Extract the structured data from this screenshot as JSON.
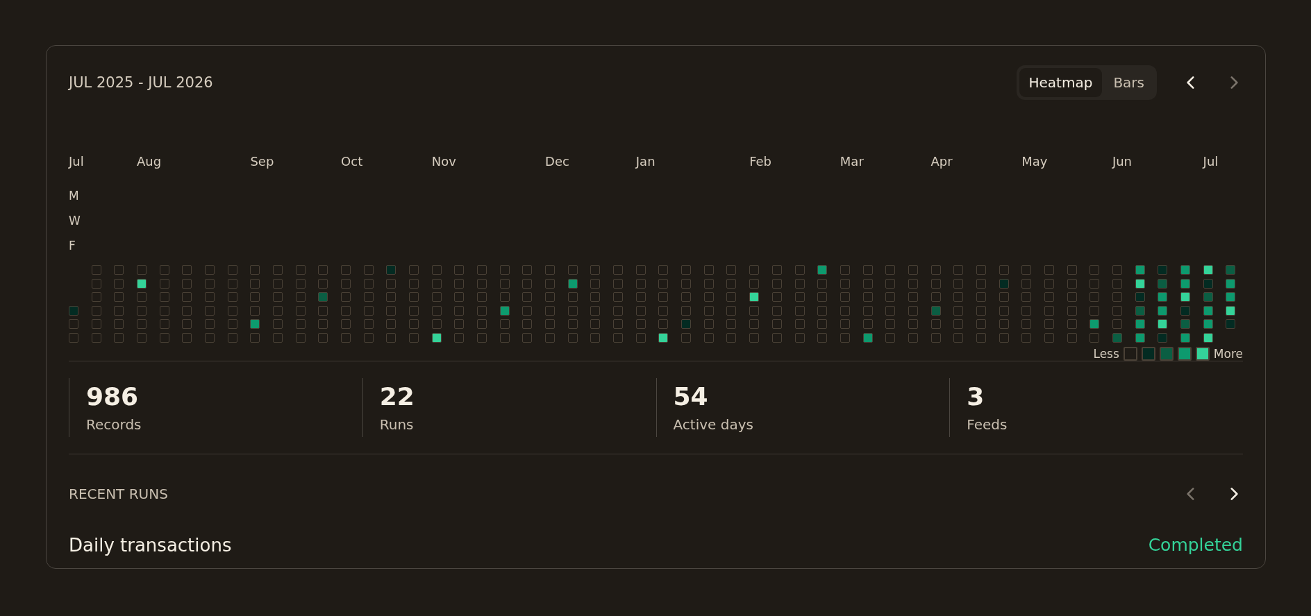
{
  "header": {
    "title": "JUL 2025 - JUL 2026",
    "view_tabs": [
      {
        "label": "Heatmap",
        "selected": true
      },
      {
        "label": "Bars",
        "selected": false
      }
    ],
    "prev": {
      "disabled": false
    },
    "next": {
      "disabled": true
    }
  },
  "heatmap": {
    "day_labels": [
      "M",
      "W",
      "F"
    ],
    "weeks": [
      {
        "month": "Jul",
        "cells": [
          {
            "kind": "pad"
          },
          {
            "kind": "pad"
          },
          {
            "kind": "pad"
          },
          {
            "kind": "day",
            "color": "#032b22"
          },
          {
            "kind": "day",
            "color": "#1f1b16"
          },
          {
            "kind": "day",
            "color": "#1f1b16"
          }
        ]
      },
      {
        "cells": [
          {
            "kind": "day",
            "color": "#1f1b16"
          },
          {
            "kind": "day",
            "color": "#1f1b16"
          },
          {
            "kind": "day",
            "color": "#1f1b16"
          },
          {
            "kind": "day",
            "color": "#1f1b16"
          },
          {
            "kind": "day",
            "color": "#1f1b16"
          },
          {
            "kind": "day",
            "color": "#1f1b16"
          }
        ]
      },
      {
        "cells": [
          {
            "kind": "day",
            "color": "#1f1b16"
          },
          {
            "kind": "day",
            "color": "#1f1b16"
          },
          {
            "kind": "day",
            "color": "#1f1b16"
          },
          {
            "kind": "day",
            "color": "#1f1b16"
          },
          {
            "kind": "day",
            "color": "#1f1b16"
          },
          {
            "kind": "day",
            "color": "#1f1b16"
          }
        ]
      },
      {
        "month": "Aug",
        "cells": [
          {
            "kind": "day",
            "color": "#1f1b16"
          },
          {
            "kind": "day",
            "color": "#34d399"
          },
          {
            "kind": "day",
            "color": "#1f1b16"
          },
          {
            "kind": "day",
            "color": "#1f1b16"
          },
          {
            "kind": "day",
            "color": "#1f1b16"
          },
          {
            "kind": "day",
            "color": "#1f1b16"
          }
        ]
      },
      {
        "cells": [
          {
            "kind": "day",
            "color": "#1f1b16"
          },
          {
            "kind": "day",
            "color": "#1f1b16"
          },
          {
            "kind": "day",
            "color": "#1f1b16"
          },
          {
            "kind": "day",
            "color": "#1f1b16"
          },
          {
            "kind": "day",
            "color": "#1f1b16"
          },
          {
            "kind": "day",
            "color": "#1f1b16"
          }
        ]
      },
      {
        "cells": [
          {
            "kind": "day",
            "color": "#1f1b16"
          },
          {
            "kind": "day",
            "color": "#1f1b16"
          },
          {
            "kind": "day",
            "color": "#1f1b16"
          },
          {
            "kind": "day",
            "color": "#1f1b16"
          },
          {
            "kind": "day",
            "color": "#1f1b16"
          },
          {
            "kind": "day",
            "color": "#1f1b16"
          }
        ]
      },
      {
        "cells": [
          {
            "kind": "day",
            "color": "#1f1b16"
          },
          {
            "kind": "day",
            "color": "#1f1b16"
          },
          {
            "kind": "day",
            "color": "#1f1b16"
          },
          {
            "kind": "day",
            "color": "#1f1b16"
          },
          {
            "kind": "day",
            "color": "#1f1b16"
          },
          {
            "kind": "day",
            "color": "#1f1b16"
          }
        ]
      },
      {
        "cells": [
          {
            "kind": "day",
            "color": "#1f1b16"
          },
          {
            "kind": "day",
            "color": "#1f1b16"
          },
          {
            "kind": "day",
            "color": "#1f1b16"
          },
          {
            "kind": "day",
            "color": "#1f1b16"
          },
          {
            "kind": "day",
            "color": "#1f1b16"
          },
          {
            "kind": "day",
            "color": "#1f1b16"
          }
        ]
      },
      {
        "month": "Sep",
        "cells": [
          {
            "kind": "day",
            "color": "#1f1b16"
          },
          {
            "kind": "day",
            "color": "#1f1b16"
          },
          {
            "kind": "day",
            "color": "#1f1b16"
          },
          {
            "kind": "day",
            "color": "#1f1b16"
          },
          {
            "kind": "day",
            "color": "#0d9a6e"
          },
          {
            "kind": "day",
            "color": "#1f1b16"
          }
        ]
      },
      {
        "cells": [
          {
            "kind": "day",
            "color": "#1f1b16"
          },
          {
            "kind": "day",
            "color": "#1f1b16"
          },
          {
            "kind": "day",
            "color": "#1f1b16"
          },
          {
            "kind": "day",
            "color": "#1f1b16"
          },
          {
            "kind": "day",
            "color": "#1f1b16"
          },
          {
            "kind": "day",
            "color": "#1f1b16"
          }
        ]
      },
      {
        "cells": [
          {
            "kind": "day",
            "color": "#1f1b16"
          },
          {
            "kind": "day",
            "color": "#1f1b16"
          },
          {
            "kind": "day",
            "color": "#1f1b16"
          },
          {
            "kind": "day",
            "color": "#1f1b16"
          },
          {
            "kind": "day",
            "color": "#1f1b16"
          },
          {
            "kind": "day",
            "color": "#1f1b16"
          }
        ]
      },
      {
        "cells": [
          {
            "kind": "day",
            "color": "#1f1b16"
          },
          {
            "kind": "day",
            "color": "#1f1b16"
          },
          {
            "kind": "day",
            "color": "#0b5e43"
          },
          {
            "kind": "day",
            "color": "#1f1b16"
          },
          {
            "kind": "day",
            "color": "#1f1b16"
          },
          {
            "kind": "day",
            "color": "#1f1b16"
          }
        ]
      },
      {
        "month": "Oct",
        "cells": [
          {
            "kind": "day",
            "color": "#1f1b16"
          },
          {
            "kind": "day",
            "color": "#1f1b16"
          },
          {
            "kind": "day",
            "color": "#1f1b16"
          },
          {
            "kind": "day",
            "color": "#1f1b16"
          },
          {
            "kind": "day",
            "color": "#1f1b16"
          },
          {
            "kind": "day",
            "color": "#1f1b16"
          }
        ]
      },
      {
        "cells": [
          {
            "kind": "day",
            "color": "#1f1b16"
          },
          {
            "kind": "day",
            "color": "#1f1b16"
          },
          {
            "kind": "day",
            "color": "#1f1b16"
          },
          {
            "kind": "day",
            "color": "#1f1b16"
          },
          {
            "kind": "day",
            "color": "#1f1b16"
          },
          {
            "kind": "day",
            "color": "#1f1b16"
          }
        ]
      },
      {
        "cells": [
          {
            "kind": "day",
            "color": "#032b22"
          },
          {
            "kind": "day",
            "color": "#1f1b16"
          },
          {
            "kind": "day",
            "color": "#1f1b16"
          },
          {
            "kind": "day",
            "color": "#1f1b16"
          },
          {
            "kind": "day",
            "color": "#1f1b16"
          },
          {
            "kind": "day",
            "color": "#1f1b16"
          }
        ]
      },
      {
        "cells": [
          {
            "kind": "day",
            "color": "#1f1b16"
          },
          {
            "kind": "day",
            "color": "#1f1b16"
          },
          {
            "kind": "day",
            "color": "#1f1b16"
          },
          {
            "kind": "day",
            "color": "#1f1b16"
          },
          {
            "kind": "day",
            "color": "#1f1b16"
          },
          {
            "kind": "day",
            "color": "#1f1b16"
          }
        ]
      },
      {
        "month": "Nov",
        "cells": [
          {
            "kind": "day",
            "color": "#1f1b16"
          },
          {
            "kind": "day",
            "color": "#1f1b16"
          },
          {
            "kind": "day",
            "color": "#1f1b16"
          },
          {
            "kind": "day",
            "color": "#1f1b16"
          },
          {
            "kind": "day",
            "color": "#1f1b16"
          },
          {
            "kind": "day",
            "color": "#34d399"
          }
        ]
      },
      {
        "cells": [
          {
            "kind": "day",
            "color": "#1f1b16"
          },
          {
            "kind": "day",
            "color": "#1f1b16"
          },
          {
            "kind": "day",
            "color": "#1f1b16"
          },
          {
            "kind": "day",
            "color": "#1f1b16"
          },
          {
            "kind": "day",
            "color": "#1f1b16"
          },
          {
            "kind": "day",
            "color": "#1f1b16"
          }
        ]
      },
      {
        "cells": [
          {
            "kind": "day",
            "color": "#1f1b16"
          },
          {
            "kind": "day",
            "color": "#1f1b16"
          },
          {
            "kind": "day",
            "color": "#1f1b16"
          },
          {
            "kind": "day",
            "color": "#1f1b16"
          },
          {
            "kind": "day",
            "color": "#1f1b16"
          },
          {
            "kind": "day",
            "color": "#1f1b16"
          }
        ]
      },
      {
        "cells": [
          {
            "kind": "day",
            "color": "#1f1b16"
          },
          {
            "kind": "day",
            "color": "#1f1b16"
          },
          {
            "kind": "day",
            "color": "#1f1b16"
          },
          {
            "kind": "day",
            "color": "#0d9a6e"
          },
          {
            "kind": "day",
            "color": "#1f1b16"
          },
          {
            "kind": "day",
            "color": "#1f1b16"
          }
        ]
      },
      {
        "cells": [
          {
            "kind": "day",
            "color": "#1f1b16"
          },
          {
            "kind": "day",
            "color": "#1f1b16"
          },
          {
            "kind": "day",
            "color": "#1f1b16"
          },
          {
            "kind": "day",
            "color": "#1f1b16"
          },
          {
            "kind": "day",
            "color": "#1f1b16"
          },
          {
            "kind": "day",
            "color": "#1f1b16"
          }
        ]
      },
      {
        "month": "Dec",
        "cells": [
          {
            "kind": "day",
            "color": "#1f1b16"
          },
          {
            "kind": "day",
            "color": "#1f1b16"
          },
          {
            "kind": "day",
            "color": "#1f1b16"
          },
          {
            "kind": "day",
            "color": "#1f1b16"
          },
          {
            "kind": "day",
            "color": "#1f1b16"
          },
          {
            "kind": "day",
            "color": "#1f1b16"
          }
        ]
      },
      {
        "cells": [
          {
            "kind": "day",
            "color": "#1f1b16"
          },
          {
            "kind": "day",
            "color": "#0d9a6e"
          },
          {
            "kind": "day",
            "color": "#1f1b16"
          },
          {
            "kind": "day",
            "color": "#1f1b16"
          },
          {
            "kind": "day",
            "color": "#1f1b16"
          },
          {
            "kind": "day",
            "color": "#1f1b16"
          }
        ]
      },
      {
        "cells": [
          {
            "kind": "day",
            "color": "#1f1b16"
          },
          {
            "kind": "day",
            "color": "#1f1b16"
          },
          {
            "kind": "day",
            "color": "#1f1b16"
          },
          {
            "kind": "day",
            "color": "#1f1b16"
          },
          {
            "kind": "day",
            "color": "#1f1b16"
          },
          {
            "kind": "day",
            "color": "#1f1b16"
          }
        ]
      },
      {
        "cells": [
          {
            "kind": "day",
            "color": "#1f1b16"
          },
          {
            "kind": "day",
            "color": "#1f1b16"
          },
          {
            "kind": "day",
            "color": "#1f1b16"
          },
          {
            "kind": "day",
            "color": "#1f1b16"
          },
          {
            "kind": "day",
            "color": "#1f1b16"
          },
          {
            "kind": "day",
            "color": "#1f1b16"
          }
        ]
      },
      {
        "month": "Jan",
        "cells": [
          {
            "kind": "day",
            "color": "#1f1b16"
          },
          {
            "kind": "day",
            "color": "#1f1b16"
          },
          {
            "kind": "day",
            "color": "#1f1b16"
          },
          {
            "kind": "day",
            "color": "#1f1b16"
          },
          {
            "kind": "day",
            "color": "#1f1b16"
          },
          {
            "kind": "day",
            "color": "#1f1b16"
          }
        ]
      },
      {
        "cells": [
          {
            "kind": "day",
            "color": "#1f1b16"
          },
          {
            "kind": "day",
            "color": "#1f1b16"
          },
          {
            "kind": "day",
            "color": "#1f1b16"
          },
          {
            "kind": "day",
            "color": "#1f1b16"
          },
          {
            "kind": "day",
            "color": "#1f1b16"
          },
          {
            "kind": "day",
            "color": "#34d399"
          }
        ]
      },
      {
        "cells": [
          {
            "kind": "day",
            "color": "#1f1b16"
          },
          {
            "kind": "day",
            "color": "#1f1b16"
          },
          {
            "kind": "day",
            "color": "#1f1b16"
          },
          {
            "kind": "day",
            "color": "#1f1b16"
          },
          {
            "kind": "day",
            "color": "#032b22"
          },
          {
            "kind": "day",
            "color": "#1f1b16"
          }
        ]
      },
      {
        "cells": [
          {
            "kind": "day",
            "color": "#1f1b16"
          },
          {
            "kind": "day",
            "color": "#1f1b16"
          },
          {
            "kind": "day",
            "color": "#1f1b16"
          },
          {
            "kind": "day",
            "color": "#1f1b16"
          },
          {
            "kind": "day",
            "color": "#1f1b16"
          },
          {
            "kind": "day",
            "color": "#1f1b16"
          }
        ]
      },
      {
        "cells": [
          {
            "kind": "day",
            "color": "#1f1b16"
          },
          {
            "kind": "day",
            "color": "#1f1b16"
          },
          {
            "kind": "day",
            "color": "#1f1b16"
          },
          {
            "kind": "day",
            "color": "#1f1b16"
          },
          {
            "kind": "day",
            "color": "#1f1b16"
          },
          {
            "kind": "day",
            "color": "#1f1b16"
          }
        ]
      },
      {
        "month": "Feb",
        "cells": [
          {
            "kind": "day",
            "color": "#1f1b16"
          },
          {
            "kind": "day",
            "color": "#1f1b16"
          },
          {
            "kind": "day",
            "color": "#34d399"
          },
          {
            "kind": "day",
            "color": "#1f1b16"
          },
          {
            "kind": "day",
            "color": "#1f1b16"
          },
          {
            "kind": "day",
            "color": "#1f1b16"
          }
        ]
      },
      {
        "cells": [
          {
            "kind": "day",
            "color": "#1f1b16"
          },
          {
            "kind": "day",
            "color": "#1f1b16"
          },
          {
            "kind": "day",
            "color": "#1f1b16"
          },
          {
            "kind": "day",
            "color": "#1f1b16"
          },
          {
            "kind": "day",
            "color": "#1f1b16"
          },
          {
            "kind": "day",
            "color": "#1f1b16"
          }
        ]
      },
      {
        "cells": [
          {
            "kind": "day",
            "color": "#1f1b16"
          },
          {
            "kind": "day",
            "color": "#1f1b16"
          },
          {
            "kind": "day",
            "color": "#1f1b16"
          },
          {
            "kind": "day",
            "color": "#1f1b16"
          },
          {
            "kind": "day",
            "color": "#1f1b16"
          },
          {
            "kind": "day",
            "color": "#1f1b16"
          }
        ]
      },
      {
        "cells": [
          {
            "kind": "day",
            "color": "#0d9a6e"
          },
          {
            "kind": "day",
            "color": "#1f1b16"
          },
          {
            "kind": "day",
            "color": "#1f1b16"
          },
          {
            "kind": "day",
            "color": "#1f1b16"
          },
          {
            "kind": "day",
            "color": "#1f1b16"
          },
          {
            "kind": "day",
            "color": "#1f1b16"
          }
        ]
      },
      {
        "month": "Mar",
        "cells": [
          {
            "kind": "day",
            "color": "#1f1b16"
          },
          {
            "kind": "day",
            "color": "#1f1b16"
          },
          {
            "kind": "day",
            "color": "#1f1b16"
          },
          {
            "kind": "day",
            "color": "#1f1b16"
          },
          {
            "kind": "day",
            "color": "#1f1b16"
          },
          {
            "kind": "day",
            "color": "#1f1b16"
          }
        ]
      },
      {
        "cells": [
          {
            "kind": "day",
            "color": "#1f1b16"
          },
          {
            "kind": "day",
            "color": "#1f1b16"
          },
          {
            "kind": "day",
            "color": "#1f1b16"
          },
          {
            "kind": "day",
            "color": "#1f1b16"
          },
          {
            "kind": "day",
            "color": "#1f1b16"
          },
          {
            "kind": "day",
            "color": "#0d9a6e"
          }
        ]
      },
      {
        "cells": [
          {
            "kind": "day",
            "color": "#1f1b16"
          },
          {
            "kind": "day",
            "color": "#1f1b16"
          },
          {
            "kind": "day",
            "color": "#1f1b16"
          },
          {
            "kind": "day",
            "color": "#1f1b16"
          },
          {
            "kind": "day",
            "color": "#1f1b16"
          },
          {
            "kind": "day",
            "color": "#1f1b16"
          }
        ]
      },
      {
        "cells": [
          {
            "kind": "day",
            "color": "#1f1b16"
          },
          {
            "kind": "day",
            "color": "#1f1b16"
          },
          {
            "kind": "day",
            "color": "#1f1b16"
          },
          {
            "kind": "day",
            "color": "#1f1b16"
          },
          {
            "kind": "day",
            "color": "#1f1b16"
          },
          {
            "kind": "day",
            "color": "#1f1b16"
          }
        ]
      },
      {
        "month": "Apr",
        "cells": [
          {
            "kind": "day",
            "color": "#1f1b16"
          },
          {
            "kind": "day",
            "color": "#1f1b16"
          },
          {
            "kind": "day",
            "color": "#1f1b16"
          },
          {
            "kind": "day",
            "color": "#0b5e43"
          },
          {
            "kind": "day",
            "color": "#1f1b16"
          },
          {
            "kind": "day",
            "color": "#1f1b16"
          }
        ]
      },
      {
        "cells": [
          {
            "kind": "day",
            "color": "#1f1b16"
          },
          {
            "kind": "day",
            "color": "#1f1b16"
          },
          {
            "kind": "day",
            "color": "#1f1b16"
          },
          {
            "kind": "day",
            "color": "#1f1b16"
          },
          {
            "kind": "day",
            "color": "#1f1b16"
          },
          {
            "kind": "day",
            "color": "#1f1b16"
          }
        ]
      },
      {
        "cells": [
          {
            "kind": "day",
            "color": "#1f1b16"
          },
          {
            "kind": "day",
            "color": "#1f1b16"
          },
          {
            "kind": "day",
            "color": "#1f1b16"
          },
          {
            "kind": "day",
            "color": "#1f1b16"
          },
          {
            "kind": "day",
            "color": "#1f1b16"
          },
          {
            "kind": "day",
            "color": "#1f1b16"
          }
        ]
      },
      {
        "cells": [
          {
            "kind": "day",
            "color": "#1f1b16"
          },
          {
            "kind": "day",
            "color": "#032b22"
          },
          {
            "kind": "day",
            "color": "#1f1b16"
          },
          {
            "kind": "day",
            "color": "#1f1b16"
          },
          {
            "kind": "day",
            "color": "#1f1b16"
          },
          {
            "kind": "day",
            "color": "#1f1b16"
          }
        ]
      },
      {
        "month": "May",
        "cells": [
          {
            "kind": "day",
            "color": "#1f1b16"
          },
          {
            "kind": "day",
            "color": "#1f1b16"
          },
          {
            "kind": "day",
            "color": "#1f1b16"
          },
          {
            "kind": "day",
            "color": "#1f1b16"
          },
          {
            "kind": "day",
            "color": "#1f1b16"
          },
          {
            "kind": "day",
            "color": "#1f1b16"
          }
        ]
      },
      {
        "cells": [
          {
            "kind": "day",
            "color": "#1f1b16"
          },
          {
            "kind": "day",
            "color": "#1f1b16"
          },
          {
            "kind": "day",
            "color": "#1f1b16"
          },
          {
            "kind": "day",
            "color": "#1f1b16"
          },
          {
            "kind": "day",
            "color": "#1f1b16"
          },
          {
            "kind": "day",
            "color": "#1f1b16"
          }
        ]
      },
      {
        "cells": [
          {
            "kind": "day",
            "color": "#1f1b16"
          },
          {
            "kind": "day",
            "color": "#1f1b16"
          },
          {
            "kind": "day",
            "color": "#1f1b16"
          },
          {
            "kind": "day",
            "color": "#1f1b16"
          },
          {
            "kind": "day",
            "color": "#1f1b16"
          },
          {
            "kind": "day",
            "color": "#1f1b16"
          }
        ]
      },
      {
        "cells": [
          {
            "kind": "day",
            "color": "#1f1b16"
          },
          {
            "kind": "day",
            "color": "#1f1b16"
          },
          {
            "kind": "day",
            "color": "#1f1b16"
          },
          {
            "kind": "day",
            "color": "#1f1b16"
          },
          {
            "kind": "day",
            "color": "#0d9a6e"
          },
          {
            "kind": "day",
            "color": "#1f1b16"
          }
        ]
      },
      {
        "month": "Jun",
        "cells": [
          {
            "kind": "day",
            "color": "#1f1b16"
          },
          {
            "kind": "day",
            "color": "#1f1b16"
          },
          {
            "kind": "day",
            "color": "#1f1b16"
          },
          {
            "kind": "day",
            "color": "#1f1b16"
          },
          {
            "kind": "day",
            "color": "#1f1b16"
          },
          {
            "kind": "day",
            "color": "#0b5e43"
          }
        ]
      },
      {
        "cells": [
          {
            "kind": "day",
            "color": "#0d9a6e"
          },
          {
            "kind": "day",
            "color": "#34d399"
          },
          {
            "kind": "day",
            "color": "#032b22"
          },
          {
            "kind": "day",
            "color": "#0b5e43"
          },
          {
            "kind": "day",
            "color": "#0d9a6e"
          },
          {
            "kind": "day",
            "color": "#0d9a6e"
          }
        ]
      },
      {
        "cells": [
          {
            "kind": "day",
            "color": "#032b22"
          },
          {
            "kind": "day",
            "color": "#0b5e43"
          },
          {
            "kind": "day",
            "color": "#0d9a6e"
          },
          {
            "kind": "day",
            "color": "#0d9a6e"
          },
          {
            "kind": "day",
            "color": "#34d399"
          },
          {
            "kind": "day",
            "color": "#032b22"
          }
        ]
      },
      {
        "cells": [
          {
            "kind": "day",
            "color": "#0d9a6e"
          },
          {
            "kind": "day",
            "color": "#0d9a6e"
          },
          {
            "kind": "day",
            "color": "#34d399"
          },
          {
            "kind": "day",
            "color": "#032b22"
          },
          {
            "kind": "day",
            "color": "#0b5e43"
          },
          {
            "kind": "day",
            "color": "#0d9a6e"
          }
        ]
      },
      {
        "month": "Jul",
        "cells": [
          {
            "kind": "day",
            "color": "#34d399"
          },
          {
            "kind": "day",
            "color": "#032b22"
          },
          {
            "kind": "day",
            "color": "#0b5e43"
          },
          {
            "kind": "day",
            "color": "#0d9a6e"
          },
          {
            "kind": "day",
            "color": "#0d9a6e"
          },
          {
            "kind": "day",
            "color": "#34d399"
          }
        ]
      },
      {
        "cells": [
          {
            "kind": "day",
            "color": "#0b5e43"
          },
          {
            "kind": "day",
            "color": "#0d9a6e"
          },
          {
            "kind": "day",
            "color": "#0d9a6e"
          },
          {
            "kind": "day",
            "color": "#34d399"
          },
          {
            "kind": "day",
            "color": "#032b22"
          },
          {
            "kind": "pad"
          }
        ]
      }
    ],
    "legend": {
      "less": "Less",
      "more": "More",
      "swatches": [
        {
          "color": "#1f1b16"
        },
        {
          "color": "#032b22"
        },
        {
          "color": "#0b5e43"
        },
        {
          "color": "#0d9a6e"
        },
        {
          "color": "#34d399"
        }
      ]
    }
  },
  "stats": [
    {
      "value": "986",
      "label": "Records"
    },
    {
      "value": "22",
      "label": "Runs"
    },
    {
      "value": "54",
      "label": "Active days"
    },
    {
      "value": "3",
      "label": "Feeds"
    }
  ],
  "recent_runs": {
    "title": "RECENT RUNS",
    "prev": {
      "disabled": true
    },
    "next": {
      "disabled": false
    },
    "items": [
      {
        "name": "Daily transactions",
        "status": "Completed"
      }
    ]
  }
}
